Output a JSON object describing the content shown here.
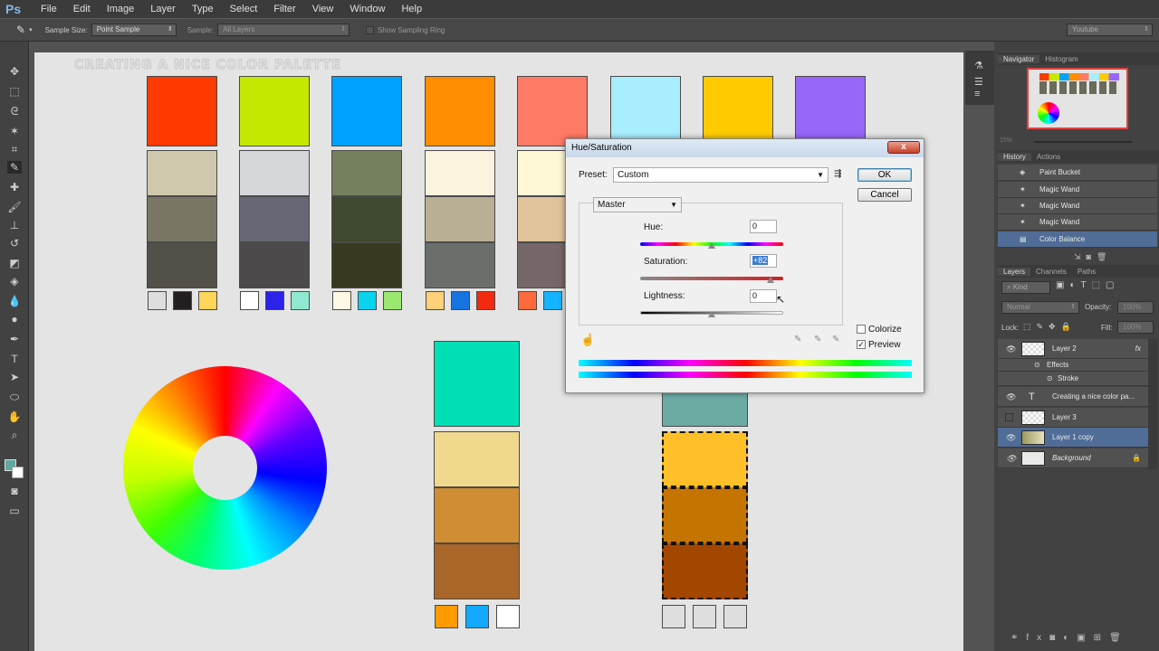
{
  "app": {
    "logo": "Ps"
  },
  "menu": [
    "File",
    "Edit",
    "Image",
    "Layer",
    "Type",
    "Select",
    "Filter",
    "View",
    "Window",
    "Help"
  ],
  "options": {
    "sample_size_label": "Sample Size:",
    "sample_size_value": "Point Sample",
    "sample_label": "Sample:",
    "sample_value": "All Layers",
    "show_ring_label": "Show Sampling Ring",
    "workspace": "Youtube"
  },
  "document": {
    "title_text": "CREATING A NICE COLOR PALETTE"
  },
  "palette": {
    "top_swatches": [
      "#ff3a00",
      "#c6e800",
      "#00a2ff",
      "#ff8d00",
      "#ff7a65",
      "#a9eefe",
      "#ffcb00",
      "#9867fa"
    ],
    "columns": [
      {
        "shades": [
          "#cfc8ac",
          "#797665",
          "#534f49"
        ],
        "minis": [
          "#dedede",
          "#231f20",
          "#ffd55a"
        ]
      },
      {
        "shades": [
          "#d6d7da",
          "#676674",
          "#4c4a4a"
        ],
        "minis": [
          "#ffffff",
          "#2d22ea",
          "#8fe9d1"
        ]
      },
      {
        "shades": [
          "#75805e",
          "#3f4a30",
          "#38391f"
        ],
        "minis": [
          "#fff8e6",
          "#09d4f0",
          "#9be870"
        ]
      },
      {
        "shades": [
          "#fcf3de",
          "#b9af95",
          "#6b6f6c"
        ],
        "minis": [
          "#ffd07a",
          "#1673e0",
          "#f22a10"
        ]
      },
      {
        "shades": [
          "#fff8d6",
          "#e0c39b",
          "#766667"
        ],
        "minis": [
          "#ff6a3c",
          "#14b4ff"
        ]
      }
    ],
    "middle_column": {
      "top": "#00dfb6",
      "shades": [
        "#f0d88c",
        "#cf8e33",
        "#a86628"
      ],
      "minis": [
        "#ff9a00",
        "#14a8ff",
        "#ffffff"
      ]
    },
    "right_column": {
      "top": "#6aaba4",
      "shades": [
        "#ffbf28",
        "#c47400",
        "#a34700"
      ],
      "minis": [
        "#dedede",
        "#dedede",
        "#dedede"
      ]
    }
  },
  "dialog": {
    "title": "Hue/Saturation",
    "close": "x",
    "preset_label": "Preset:",
    "preset_value": "Custom",
    "ok": "OK",
    "cancel": "Cancel",
    "channel": "Master",
    "hue_label": "Hue:",
    "hue_value": "0",
    "saturation_label": "Saturation:",
    "saturation_value": "+82",
    "lightness_label": "Lightness:",
    "lightness_value": "0",
    "colorize_label": "Colorize",
    "colorize_checked": false,
    "preview_label": "Preview",
    "preview_checked": true
  },
  "navigator": {
    "tabs": [
      "Navigator",
      "Histogram"
    ],
    "zoom": "15%"
  },
  "history": {
    "tabs": [
      "History",
      "Actions"
    ],
    "items": [
      "Paint Bucket",
      "Magic Wand",
      "Magic Wand",
      "Magic Wand",
      "Color Balance"
    ],
    "selected_index": 4
  },
  "layers": {
    "tabs": [
      "Layers",
      "Channels",
      "Paths"
    ],
    "kind": "Kind",
    "blend_mode": "Normal",
    "opacity_label": "Opacity:",
    "opacity_value": "100%",
    "lock_label": "Lock:",
    "fill_label": "Fill:",
    "fill_value": "100%",
    "items": [
      {
        "name": "Layer 2",
        "fx": "fx"
      },
      {
        "name": "Effects"
      },
      {
        "name": "Stroke"
      },
      {
        "name": "Creating a nice color pa..."
      },
      {
        "name": "Layer 3"
      },
      {
        "name": "Layer 1 copy"
      },
      {
        "name": "Background"
      }
    ],
    "selected": "Layer 1 copy"
  }
}
